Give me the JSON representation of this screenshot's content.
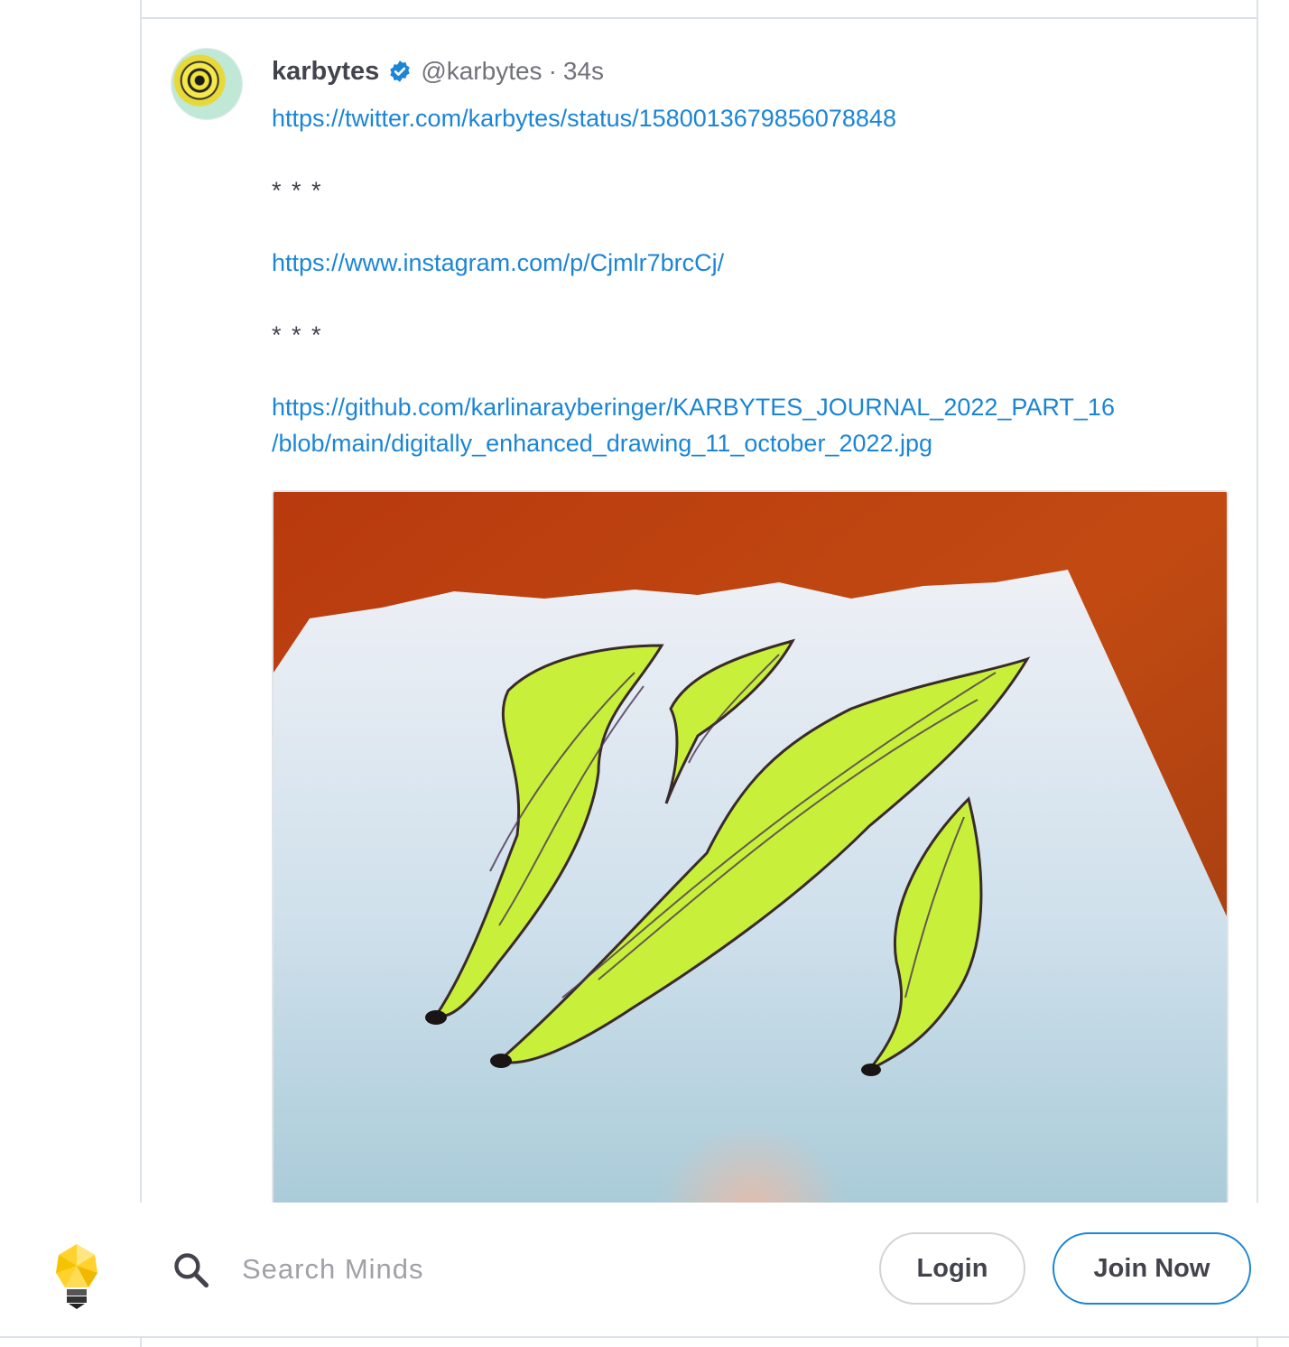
{
  "post": {
    "author_name": "karbytes",
    "author_handle": "@karbytes",
    "separator": "·",
    "time_ago": "34s",
    "links": [
      "https://twitter.com/karbytes/status/1580013679856078848",
      "https://www.instagram.com/p/Cjmlr7brcCj/",
      "https://github.com/karlinarayberinger/KARBYTES_JOURNAL_2022_PART_16/blob/main/digitally_enhanced_drawing_11_october_2022.jpg"
    ],
    "link_github_line1": "https://github.com/karlinarayberinger/KARBYTES_JOURNAL_2022_PART_16",
    "link_github_line2": "/blob/main/digitally_enhanced_drawing_11_october_2022.jpg",
    "separator_stars": "* * *"
  },
  "bottom_bar": {
    "search_placeholder": "Search Minds",
    "login_label": "Login",
    "join_label": "Join Now"
  },
  "colors": {
    "link": "#1b85d6",
    "text": "#43434d",
    "muted": "#72727c",
    "border": "#dce2e9",
    "verified": "#1b85d6"
  },
  "icons": [
    "verified-badge-icon",
    "search-icon",
    "minds-logo-icon"
  ]
}
